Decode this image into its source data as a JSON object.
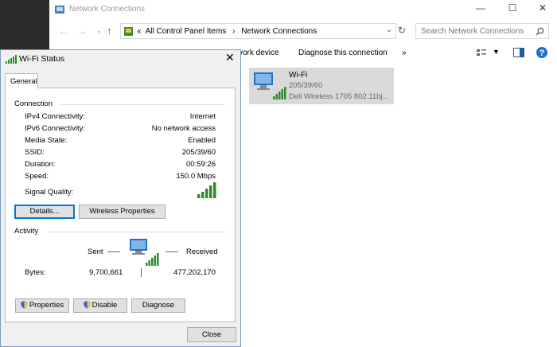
{
  "explorer": {
    "title": "Network Connections",
    "address": {
      "chevrons": "«",
      "crumbs": [
        "All Control Panel Items",
        "Network Connections"
      ]
    },
    "search_placeholder": "Search Network Connections",
    "toolbar": {
      "partial_left": "vork device",
      "diagnose": "Diagnose this connection",
      "more": "»"
    },
    "item": {
      "name": "Wi-Fi",
      "ssid": "205/39/60",
      "device": "Dell Wireless 1705 802.11bj..."
    }
  },
  "dialog": {
    "title": "Wi-Fi Status",
    "tab": "General",
    "connection": {
      "heading": "Connection",
      "rows": [
        {
          "label": "IPv4 Connectivity:",
          "value": "Internet"
        },
        {
          "label": "IPv6 Connectivity:",
          "value": "No network access"
        },
        {
          "label": "Media State:",
          "value": "Enabled"
        },
        {
          "label": "SSID:",
          "value": "205/39/60"
        },
        {
          "label": "Duration:",
          "value": "00:59:26"
        },
        {
          "label": "Speed:",
          "value": "150.0 Mbps"
        }
      ],
      "signal_label": "Signal Quality:"
    },
    "buttons": {
      "details": "Details...",
      "wireless": "Wireless Properties"
    },
    "activity": {
      "heading": "Activity",
      "sent": "Sent",
      "received": "Received",
      "bytes_label": "Bytes:",
      "bytes_sent": "9,700,661",
      "bytes_received": "477,202,170"
    },
    "bottom": {
      "properties": "Properties",
      "disable": "Disable",
      "diagnose": "Diagnose",
      "close": "Close"
    },
    "colors": {
      "signal": "#2e8b2e",
      "focus": "#0078d7"
    }
  }
}
